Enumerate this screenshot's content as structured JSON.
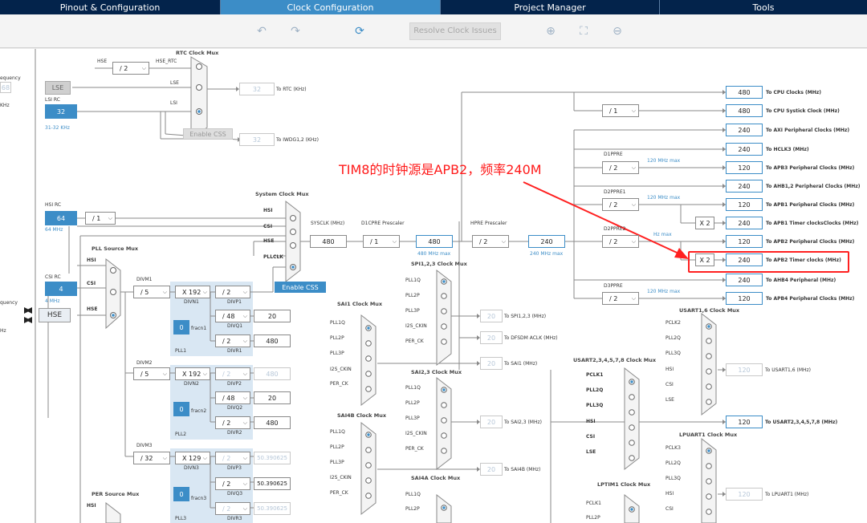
{
  "tabs": [
    "Pinout & Configuration",
    "Clock Configuration",
    "Project Manager",
    "Tools"
  ],
  "toolbar": {
    "undo_icon": "undo-icon",
    "redo_icon": "redo-icon",
    "refresh_icon": "refresh-icon",
    "resolve_label": "Resolve Clock Issues",
    "zoom_in_icon": "zoom-in-icon",
    "fit_icon": "fit-screen-icon",
    "zoom_out_icon": "zoom-out-icon"
  },
  "left": {
    "frequency_cut": "equency",
    "lse_value": "68",
    "khz_cut": "KHz",
    "lse_label": "LSE",
    "lsi_rc": "LSI RC",
    "lsi_value": "32",
    "lsi_range": "31-32 KHz",
    "hsi_rc": "HSI RC",
    "hsi_value": "64",
    "hsi_freq": "64 MHz",
    "csi_rc": "CSI RC",
    "csi_value": "4",
    "csi_freq": "4 MHz",
    "input_freq_cut": "quency",
    "hse_label": "HSE",
    "mhz_cut": "Hz"
  },
  "rtc": {
    "title": "RTC Clock Mux",
    "hse": "HSE",
    "div": "/ 2",
    "hse_rtc": "HSE_RTC",
    "lse": "LSE",
    "lsi": "LSI",
    "out_value": "32",
    "out_label": "To RTC (KHz)",
    "enable_css": "Enable CSS",
    "iwdg_value": "32",
    "iwdg_label": "To IWDG1,2 (KHz)"
  },
  "sysmux": {
    "title": "System Clock Mux",
    "hsi": "HSI",
    "csi": "CSI",
    "hse": "HSE",
    "pllclk": "PLLCLK",
    "enable_css": "Enable CSS",
    "hsi_div": "/ 1"
  },
  "sys": {
    "sysclk_label": "SYSCLK (MHz)",
    "sysclk": "480",
    "d1cpre_label": "D1CPRE Prescaler",
    "d1cpre": "/ 1",
    "cpu_value": "480",
    "cpu_max": "480 MHz max",
    "hpre_label": "HPRE Prescaler",
    "hpre": "/ 2",
    "hclk": "240",
    "hclk_max": "240 MHz max"
  },
  "pll": {
    "source_title": "PLL Source Mux",
    "hsi": "HSI",
    "csi": "CSI",
    "hse": "HSE",
    "divm1_label": "DIVM1",
    "divm1": "/ 5",
    "divn1": "X 192",
    "divn1_label": "DIVN1",
    "divp1": "/ 2",
    "divp1_label": "DIVP1",
    "divq1": "/ 48",
    "divq1_label": "DIVQ1",
    "divq1_out": "20",
    "fracn1_val": "0",
    "fracn1": "fracn1",
    "divr1": "/ 2",
    "divr1_label": "DIVR1",
    "divr1_out": "480",
    "pll1": "PLL1",
    "divm2_label": "DIVM2",
    "divm2": "/ 5",
    "divn2": "X 192",
    "divn2_label": "DIVN2",
    "divp2": "/ 2",
    "divp2_label": "DIVP2",
    "divp2_out": "480",
    "divq2": "/ 48",
    "divq2_label": "DIVQ2",
    "divq2_out": "20",
    "fracn2_val": "0",
    "fracn2": "fracn2",
    "divr2": "/ 2",
    "divr2_label": "DIVR2",
    "divr2_out": "480",
    "pll2": "PLL2",
    "divm3_label": "DIVM3",
    "divm3": "/ 32",
    "divn3": "X 129",
    "divn3_label": "DIVN3",
    "divp3": "/ 2",
    "divp3_label": "DIVP3",
    "divp3_out": "50.390625",
    "divq3": "/ 2",
    "divq3_label": "DIVQ3",
    "divq3_out": "50.390625",
    "fracn3_val": "0",
    "fracn3": "fracn3",
    "divr3": "/ 2",
    "divr3_label": "DIVR3",
    "divr3_out": "50.390625",
    "pll3": "PLL3",
    "per_title": "PER Source Mux",
    "per_hsi": "HSI"
  },
  "outputs": [
    {
      "value": "480",
      "label": "To CPU Clocks (MHz)"
    },
    {
      "value": "480",
      "label": "To CPU Systick Clock (MHz)"
    },
    {
      "value": "240",
      "label": "To AXI Peripheral Clocks (MHz)"
    },
    {
      "value": "240",
      "label": "To HCLK3 (MHz)"
    },
    {
      "value": "120",
      "label": "To APB3 Peripheral Clocks (MHz)"
    },
    {
      "value": "240",
      "label": "To AHB1,2 Peripheral Clocks (MHz)"
    },
    {
      "value": "120",
      "label": "To APB1 Peripheral Clocks (MHz)"
    },
    {
      "value": "240",
      "label": "To APB1 Timer clocksClocks (MHz)"
    },
    {
      "value": "120",
      "label": "To APB2 Peripheral Clocks (MHz)"
    },
    {
      "value": "240",
      "label": "To APB2 Timer clocks (MHz)"
    },
    {
      "value": "240",
      "label": "To AHB4 Peripheral (MHz)"
    },
    {
      "value": "120",
      "label": "To APB4 Peripheral Clocks (MHz)"
    }
  ],
  "presc": {
    "systick": "/ 1",
    "d1ppre": "D1PPRE",
    "d1ppre_val": "/ 2",
    "max120": "120 MHz max",
    "d2ppre1": "D2PPRE1",
    "d2ppre1_val": "/ 2",
    "d2ppre2": "D2PPRE2",
    "d2ppre2_val": "/ 2",
    "d3ppre": "D3PPRE",
    "d3ppre_val": "/ 2",
    "x2a": "X 2",
    "x2b": "X 2",
    "max_cut": "Hz max"
  },
  "mid": {
    "spi_title": "SPI1,2,3 Clock Mux",
    "spi_in": [
      "PLL1Q",
      "PLL2P",
      "PLL3P",
      "I2S_CKIN",
      "PER_CK"
    ],
    "spi_val": "20",
    "spi_label": "To SPI1,2,3 (MHz)",
    "dfsdm_val": "20",
    "dfsdm_label": "To DFSDM ACLK (MHz)",
    "sai1_title": "SAI1 Clock Mux",
    "sai1_in": [
      "PLL1Q",
      "PLL2P",
      "PLL3P",
      "I2S_CKIN",
      "PER_CK"
    ],
    "sai1_val": "20",
    "sai1_label": "To SAI1 (MHz)",
    "sai23_title": "SAI2,3 Clock Mux",
    "sai23_in": [
      "PLL1Q",
      "PLL2P",
      "PLL3P",
      "I2S_CKIN",
      "PER_CK"
    ],
    "sai23_val": "20",
    "sai23_label": "To SAI2,3 (MHz)",
    "sai4b_title": "SAI4B Clock Mux",
    "sai4b_in": [
      "PLL1Q",
      "PLL2P",
      "PLL3P",
      "I2S_CKIN",
      "PER_CK"
    ],
    "sai4b_val": "20",
    "sai4b_label": "To SAI4B (MHz)",
    "sai4a_title": "SAI4A Clock Mux",
    "sai4a_in": [
      "PLL1Q",
      "PLL2P"
    ]
  },
  "right": {
    "usart16_title": "USART1,6 Clock Mux",
    "usart16_in": [
      "PCLK2",
      "PLL2Q",
      "PLL3Q",
      "HSI",
      "CSI",
      "LSE"
    ],
    "usart16_val": "120",
    "usart16_label": "To USART1,6 (MHz)",
    "usart2_title": "USART2,3,4,5,7,8 Clock Mux",
    "usart2_in": [
      "PCLK1",
      "PLL2Q",
      "PLL3Q",
      "HSI",
      "CSI",
      "LSE"
    ],
    "usart2_val": "120",
    "usart2_label": "To USART2,3,4,5,7,8 (MHz)",
    "lpuart_title": "LPUART1 Clock Mux",
    "lpuart_in": [
      "PCLK3",
      "PLL2Q",
      "PLL3Q",
      "HSI",
      "CSI"
    ],
    "lpuart_val": "120",
    "lpuart_label": "To LPUART1 (MHz)",
    "lptim_title": "LPTIM1 Clock Mux",
    "lptim_in": [
      "PCLK1",
      "PLL2P"
    ]
  },
  "annotation": "TIM8的时钟源是APB2，频率240M",
  "colors": {
    "accent": "#3c8dc7",
    "header": "#03234b",
    "annotation": "#ff1a1a"
  }
}
